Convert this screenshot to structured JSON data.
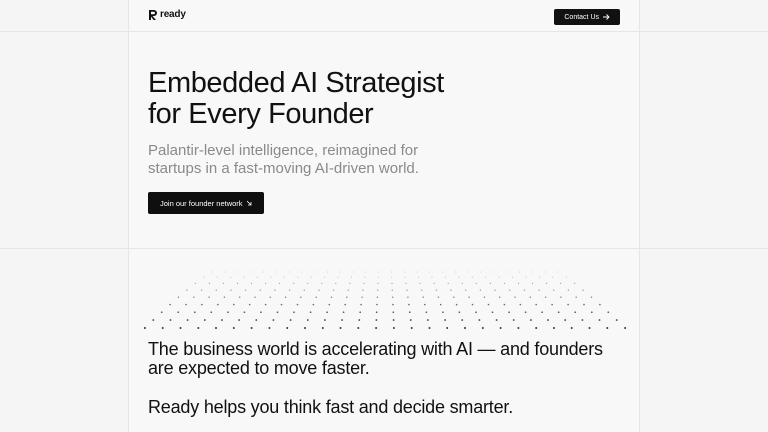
{
  "header": {
    "logo_text": "ready",
    "logo_icon": "ready-logo-icon",
    "contact_label": "Contact Us",
    "contact_icon": "arrow-right-icon"
  },
  "hero": {
    "title_line1": "Embedded AI Strategist",
    "title_line2": "for Every Founder",
    "subtitle": "Palantir-level intelligence, reimagined for startups in a fast-moving AI-driven world.",
    "cta_label": "Join our founder network",
    "cta_icon": "arrow-down-right-icon"
  },
  "section": {
    "statement": "The business world is accelerating with AI — and founders are expected to move faster.",
    "tagline": "Ready helps you think fast and decide smarter."
  },
  "colors": {
    "background": "#f5f5f5",
    "text": "#111111",
    "muted": "#8a8a8a",
    "button": "#111111"
  }
}
